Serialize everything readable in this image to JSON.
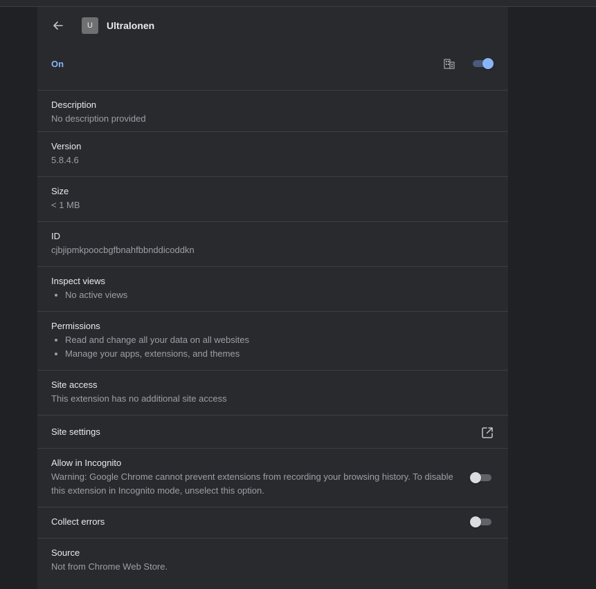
{
  "header": {
    "title": "Ultralonen",
    "icon_letter": "U"
  },
  "status": {
    "on_label": "On"
  },
  "sections": {
    "description": {
      "title": "Description",
      "value": "No description provided"
    },
    "version": {
      "title": "Version",
      "value": "5.8.4.6"
    },
    "size": {
      "title": "Size",
      "value": "< 1 MB"
    },
    "id": {
      "title": "ID",
      "value": "cjbjipmkpoocbgfbnahfbbnddicoddkn"
    },
    "inspect": {
      "title": "Inspect views",
      "items": [
        "No active views"
      ]
    },
    "permissions": {
      "title": "Permissions",
      "items": [
        "Read and change all your data on all websites",
        "Manage your apps, extensions, and themes"
      ]
    },
    "site_access": {
      "title": "Site access",
      "value": "This extension has no additional site access"
    },
    "site_settings": {
      "title": "Site settings"
    },
    "incognito": {
      "title": "Allow in Incognito",
      "warning": "Warning: Google Chrome cannot prevent extensions from recording your browsing history. To disable this extension in Incognito mode, unselect this option."
    },
    "collect_errors": {
      "title": "Collect errors"
    },
    "source": {
      "title": "Source",
      "value": "Not from Chrome Web Store."
    }
  },
  "toggles": {
    "enabled": true,
    "incognito": false,
    "collect_errors": false
  },
  "colors": {
    "accent": "#8ab4f8",
    "background": "#202124",
    "card": "#292a2d"
  },
  "icons": {
    "back": "arrow-back-icon",
    "policy": "enterprise-building-icon",
    "external": "open-in-new-icon"
  }
}
